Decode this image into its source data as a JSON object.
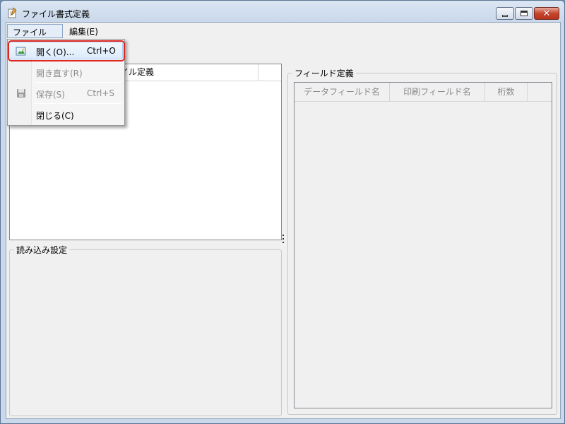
{
  "window": {
    "title": "ファイル書式定義",
    "icon": "document-pen-icon"
  },
  "menubar": {
    "file_label": "ファイル(F)",
    "edit_label": "編集(E)"
  },
  "file_menu": {
    "items": [
      {
        "label": "開く(O)...",
        "shortcut": "Ctrl+O",
        "icon": "open-folder-icon",
        "enabled": true,
        "highlighted": true
      },
      {
        "label": "開き直す(R)",
        "shortcut": "",
        "icon": "",
        "enabled": false
      },
      {
        "label": "保存(S)",
        "shortcut": "Ctrl+S",
        "icon": "floppy-disk-icon",
        "enabled": false
      },
      {
        "label": "閉じる(C)",
        "shortcut": "",
        "icon": "",
        "enabled": true
      }
    ]
  },
  "left_list": {
    "columns": [
      "イル定義",
      ""
    ]
  },
  "read_settings": {
    "legend": "読み込み設定"
  },
  "field_definition": {
    "legend": "フィールド定義",
    "columns": [
      "データフィールド名",
      "印刷フィールド名",
      "桁数"
    ]
  },
  "colors": {
    "titlebar": "#c9d8ea",
    "highlight_border": "#e0261c",
    "close_button": "#c7452c"
  }
}
